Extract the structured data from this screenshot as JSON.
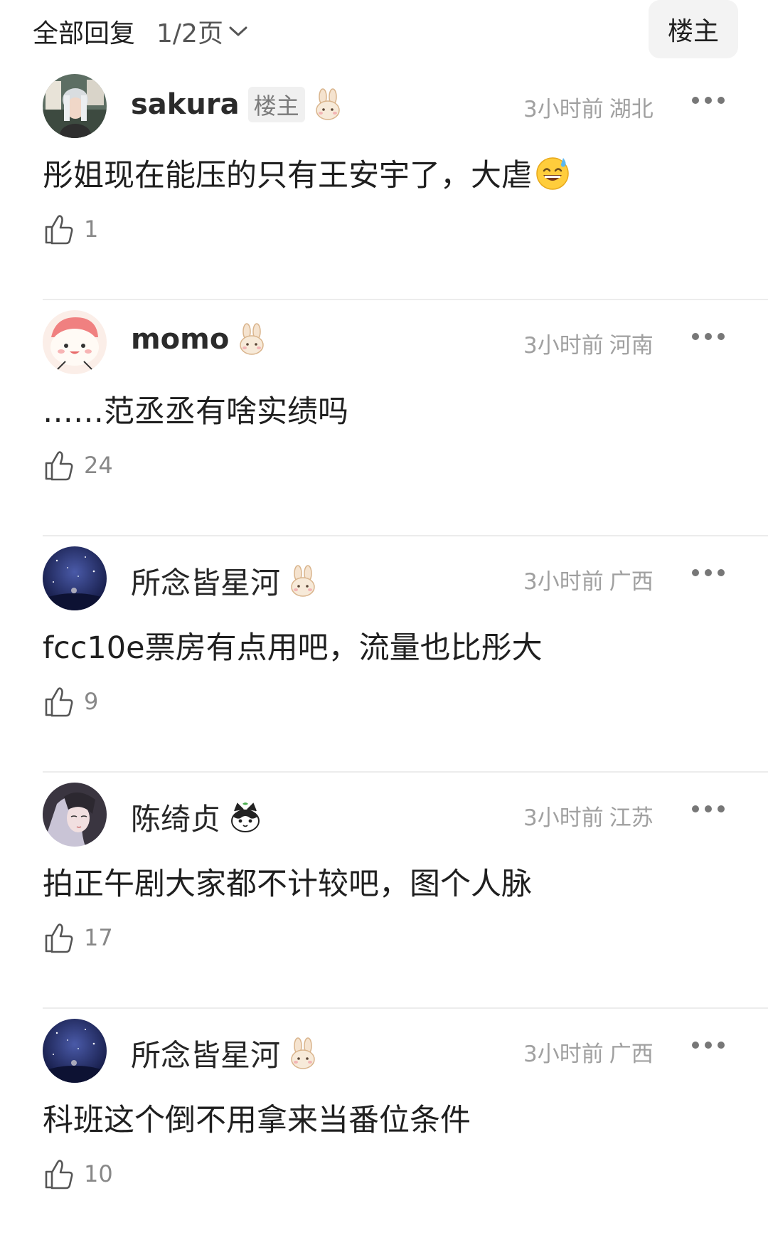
{
  "header": {
    "title": "全部回复",
    "page_indicator": "1/2页",
    "op_filter_label": "楼主"
  },
  "comments": [
    {
      "username": "sakura",
      "op_badge": "楼主",
      "time": "3小时前",
      "location": "湖北",
      "text": "彤姐现在能压的只有王安宇了，大虐",
      "likes": "1",
      "has_emoji": true
    },
    {
      "username": "momo",
      "time": "3小时前",
      "location": "河南",
      "text": "……范丞丞有啥实绩吗",
      "likes": "24"
    },
    {
      "username": "所念皆星河",
      "time": "3小时前",
      "location": "广西",
      "text": "fcc10e票房有点用吧，流量也比彤大",
      "likes": "9"
    },
    {
      "username": "陈绮贞",
      "time": "3小时前",
      "location": "江苏",
      "text": "拍正午剧大家都不计较吧，图个人脉",
      "likes": "17"
    },
    {
      "username": "所念皆星河",
      "time": "3小时前",
      "location": "广西",
      "text": "科班这个倒不用拿来当番位条件",
      "likes": "10"
    }
  ]
}
